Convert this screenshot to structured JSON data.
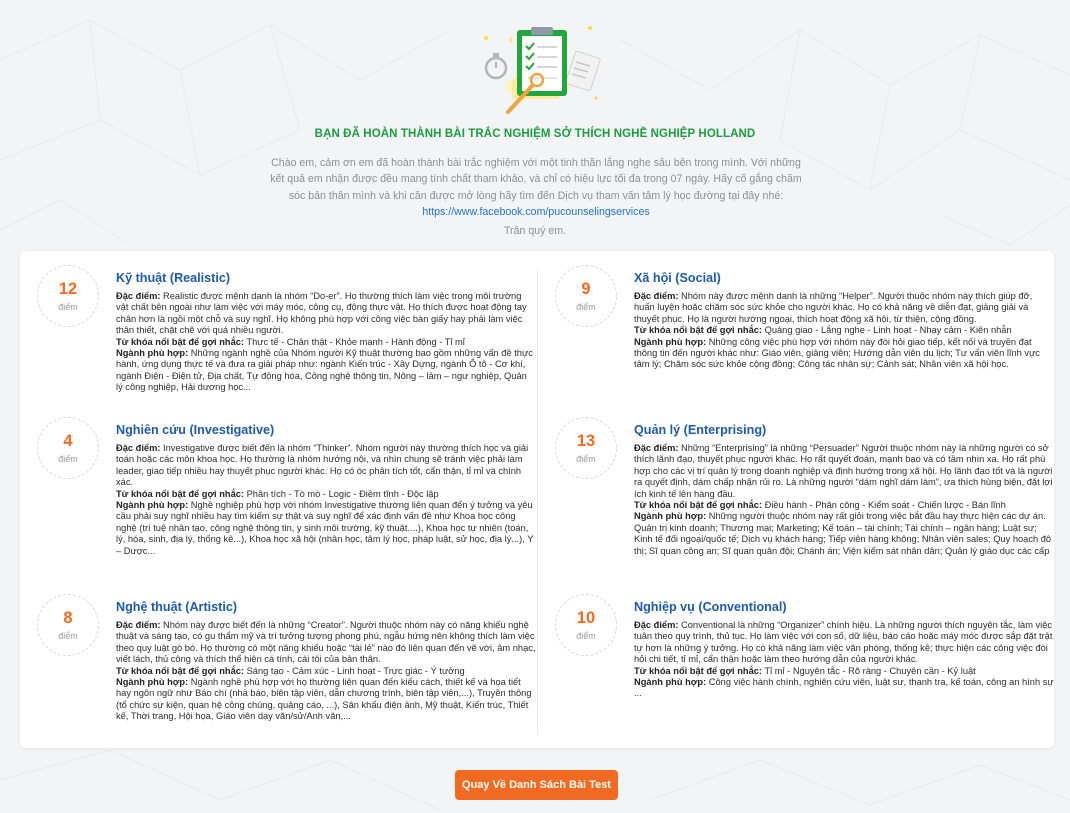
{
  "header": {
    "title": "BẠN ĐÃ HOÀN THÀNH BÀI TRẮC NGHIỆM SỞ THÍCH NGHỀ NGHIỆP HOLLAND",
    "intro": "Chào em, cảm ơn em đã hoàn thành bài trắc nghiệm với một tinh thần lắng nghe sâu bên trong mình. Với những kết quả em nhận được đều mang tính chất tham khảo, và chỉ có hiệu lực tối đa trong 07 ngày. Hãy cố gắng chăm sóc bản thân mình và khi cần được mở lòng hãy tìm đến Dịch vụ tham vấn tâm lý học đường tại đây nhé:",
    "link_text": "https://www.facebook.com/pucounselingservices",
    "thanks": "Trân quý em."
  },
  "labels": {
    "point_unit": "điểm",
    "traits": "Đặc điểm:",
    "keywords": "Từ khóa nổi bật để gợi nhắc:",
    "careers": "Ngành phù hợp:"
  },
  "groups": [
    {
      "score": "12",
      "title": "Kỹ thuật (Realistic)",
      "traits": "Realistic được mệnh danh là nhóm “Do-er”. Họ thường thích làm việc trong môi trường vật chất bên ngoài như làm việc với máy móc, công cụ, động thực vật. Họ thích được hoạt động tay chân hơn là ngồi một chỗ và suy nghĩ. Họ không phù hợp với công việc bàn giấy hay phải làm việc thân thiết, chặt chẽ với quá nhiều người.",
      "keywords": "Thực tế - Chân thật - Khỏe mạnh - Hành động - Tỉ mỉ",
      "careers": "Những ngành nghề của Nhóm người Kỹ thuật thường bao gồm những vấn đề thực hành, ứng dụng thực tế và đưa ra giải pháp như: ngành Kiến trúc - Xây Dựng, ngành Ô tô - Cơ khí, ngành Điện - Điện tử, Địa chất, Tự động hóa, Công nghệ thông tin, Nông – lâm – ngư nghiệp, Quản lý công nghiệp, Hải dương học..."
    },
    {
      "score": "9",
      "title": "Xã hội (Social)",
      "traits": "Nhóm này được mệnh danh là những “Helper”. Người thuộc nhóm này thích giúp đỡ, huấn luyện hoặc chăm sóc sức khỏe cho người khác. Họ có khả năng về diễn đạt, giảng giải và thuyết phục. Họ là người hướng ngoại, thích hoạt động xã hội, từ thiện, cộng đồng.",
      "keywords": "Quảng giao - Lắng nghe - Linh hoạt - Nhạy cảm - Kiên nhẫn",
      "careers": "Những công việc phù hợp với nhóm này đòi hỏi giao tiếp, kết nối và truyền đạt thông tin đến người khác như: Giáo viên, giảng viên; Hướng dẫn viên du lịch; Tư vấn viên lĩnh vực tâm lý; Chăm sóc sức khỏe cộng đồng; Công tác nhân sự; Cảnh sát; Nhân viên xã hội học."
    },
    {
      "score": "4",
      "title": "Nghiên cứu (Investigative)",
      "traits": "Investigative được biết đến là nhóm “Thinker”. Nhóm người này thường thích học và giải toán hoặc các môn khoa học. Họ thường là nhóm hướng nội, và nhìn chung sẽ tránh việc phải làm leader, giao tiếp nhiều hay thuyết phục người khác. Họ có óc phân tích tốt, cẩn thận, tỉ mỉ và chính xác.",
      "keywords": "Phân tích - Tò mò - Logic - Điềm tĩnh - Độc lập",
      "careers": "Nghề nghiệp phù hợp với nhóm Investigative thường liên quan đến ý tưởng và yêu cầu phải suy nghĩ nhiều hay tìm kiếm sự thật và suy nghĩ để xác định vấn đề như Khoa học công nghệ (trí tuệ nhân tạo, công nghệ thông tin, y sinh môi trường, kỹ thuật....), Khoa học tự nhiên (toán, lý, hóa, sinh, địa lý, thống kê...), Khoa học xã hội (nhân học, tâm lý học, pháp luật, sử học, địa lý...), Y – Dược..."
    },
    {
      "score": "13",
      "title": "Quản lý (Enterprising)",
      "traits": "Những “Enterprising” là những “Persuader” Người thuộc nhóm này là những người có sở thích lãnh đạo, thuyết phục người khác. Họ rất quyết đoán, mạnh bạo và có tầm nhìn xa. Họ rất phù hợp cho các vị trí quản lý trong doanh nghiệp và định hướng trong xã hội. Họ lãnh đạo tốt và là người ra quyết định, dám chấp nhận rủi ro. Là những người “dám nghĩ dám làm”, ưa thích hùng biện, đặt lợi ích kinh tế lên hàng đầu.",
      "keywords": "Điều hành - Phân công - Kiểm soát - Chiến lược - Bán lĩnh",
      "careers": "Những người thuộc nhóm này rất giỏi trong việc bắt đầu hay thực hiện các dự án. Quản trị kinh doanh; Thương mại; Marketing; Kế toán – tài chính; Tài chính – ngân hàng; Luật sư; Kinh tế đối ngoại/quốc tế; Dịch vụ khách hàng; Tiếp viên hàng không; Nhân viên sales; Quy hoạch đô thị; Sĩ quan công an; Sĩ quan quân đội; Chánh án; Viện kiểm sát nhân dân; Quản lý giáo dục các cấp"
    },
    {
      "score": "8",
      "title": "Nghệ thuật (Artistic)",
      "traits": "Nhóm này được biết đến là những “Creator”. Người thuộc nhóm này có năng khiếu nghệ thuật và sáng tạo, có gu thẩm mỹ và trí tưởng tượng phong phú, ngẫu hứng nên không thích làm việc theo quy luật gò bó. Họ thường có một năng khiếu hoặc “tài lẻ” nào đó liên quan đến vẽ vời, âm nhạc, viết lách, thủ công và thích thể hiện cá tính, cái tôi của bản thân.",
      "keywords": "Sáng tạo - Cảm xúc - Linh hoạt - Trực giác - Ý tưởng",
      "careers": "Ngành nghề phù hợp với họ thường liên quan đến kiểu cách, thiết kế và họa tiết hay ngôn ngữ như Báo chí (nhà báo, biên tập viên, dẫn chương trình, biên tập viên,...), Truyền thông (tổ chức sự kiện, quan hệ công chúng, quảng cáo, ...), Sân khấu điện ảnh, Mỹ thuật, Kiến trúc, Thiết kế, Thời trang, Hội họa, Giáo viên dạy văn/sử/Anh văn,..."
    },
    {
      "score": "10",
      "title": "Nghiệp vụ (Conventional)",
      "traits": "Conventional là những “Organizer” chính hiệu. Là những người thích nguyên tắc, làm việc tuân theo quy trình, thủ tục. Họ làm việc với con số, dữ liệu, báo cáo hoặc máy móc được sắp đặt trật tự hơn là những ý tưởng. Họ có khả năng làm việc văn phòng, thống kê; thực hiện các công việc đòi hỏi chi tiết, tỉ mỉ, cẩn thận hoặc làm theo hướng dẫn của người khác.",
      "keywords": "Tỉ mỉ - Nguyên tắc - Rõ ràng - Chuyên cần - Kỷ luật",
      "careers": "Công việc hành chính, nghiên cứu viên, luật sư, thanh tra, kế toán, công an hình sự ..."
    }
  ],
  "footer": {
    "back_button": "Quay Về Danh Sách Bài Test"
  },
  "colors": {
    "accent": "#f26a21",
    "title_green": "#1a9c3f",
    "group_title": "#1e5aa8",
    "link": "#1e73c9"
  }
}
